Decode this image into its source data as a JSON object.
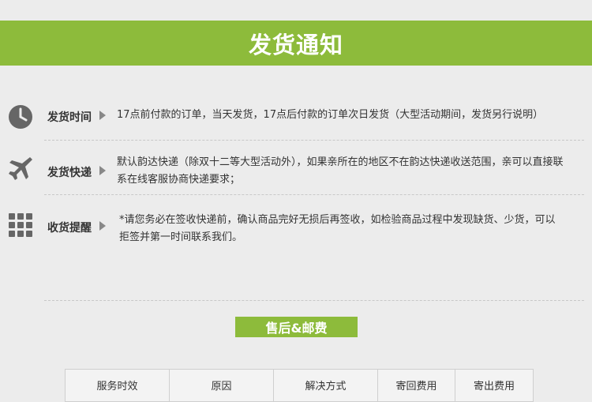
{
  "header": {
    "title": "发货通知"
  },
  "rows": [
    {
      "icon": "clock-icon",
      "label": "发货时间",
      "text": "17点前付款的订单，当天发货，17点后付款的订单次日发货（大型活动期间，发货另行说明）"
    },
    {
      "icon": "airplane-icon",
      "label": "发货快递",
      "text": "默认韵达快递（除双十二等大型活动外），如果亲所在的地区不在韵达快递收送范围，亲可以直接联系在线客服协商快递要求；"
    },
    {
      "icon": "grid-icon",
      "label": "收货提醒",
      "text": "*请您务必在签收快递前，确认商品完好无损后再签收，如检验商品过程中发现缺货、少货，可以拒签并第一时间联系我们。"
    }
  ],
  "section2": {
    "title": "售后&邮费"
  },
  "table": {
    "headers": [
      "服务时效",
      "原因",
      "解决方式",
      "寄回费用",
      "寄出费用"
    ]
  },
  "colors": {
    "accent": "#8dbb3b",
    "background": "#ececec",
    "icon": "#666666"
  }
}
